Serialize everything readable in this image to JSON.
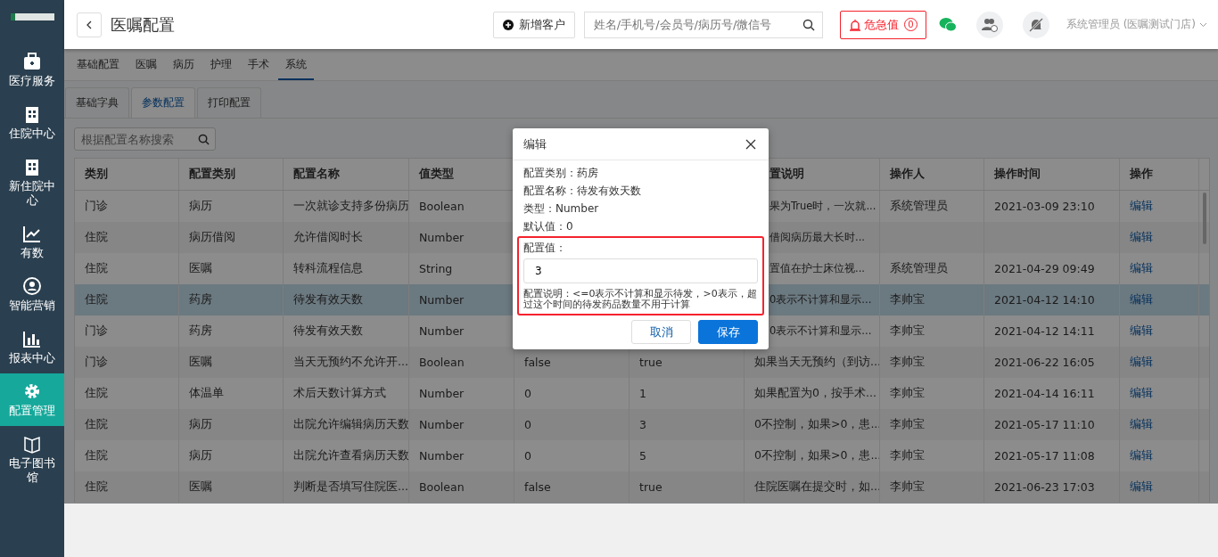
{
  "sidebar": {
    "items": [
      {
        "label": "医疗服务",
        "selected": false
      },
      {
        "label": "住院中心",
        "selected": false
      },
      {
        "label": "新住院中心",
        "selected": false
      },
      {
        "label": "有数",
        "selected": false
      },
      {
        "label": "智能营销",
        "selected": false
      },
      {
        "label": "报表中心",
        "selected": false
      },
      {
        "label": "配置管理",
        "selected": true
      },
      {
        "label": "电子图书馆",
        "selected": false
      }
    ]
  },
  "header": {
    "title": "医嘱配置",
    "add_button": "新增客户",
    "search": {
      "placeholder": "姓名/手机号/会员号/病历号/微信号"
    },
    "alert_button": {
      "label": "危急值",
      "count": "0"
    },
    "user": "系统管理员 (医嘱测试门店)"
  },
  "tabs": [
    {
      "label": "基础配置",
      "selected": false
    },
    {
      "label": "医嘱",
      "selected": false
    },
    {
      "label": "病历",
      "selected": false
    },
    {
      "label": "护理",
      "selected": false
    },
    {
      "label": "手术",
      "selected": false
    },
    {
      "label": "系统",
      "selected": true
    }
  ],
  "sub_tabs": [
    {
      "label": "基础字典",
      "selected": false
    },
    {
      "label": "参数配置",
      "selected": true
    },
    {
      "label": "打印配置",
      "selected": false
    }
  ],
  "filter": {
    "placeholder": "根据配置名称搜索"
  },
  "table": {
    "columns": [
      "类别",
      "配置类别",
      "配置名称",
      "值类型",
      null,
      null,
      "置说明",
      "操作人",
      "操作时间",
      "操作"
    ],
    "rows": [
      {
        "selected": false,
        "cells": [
          "门诊",
          "病历",
          "一次就诊支持多份病历",
          "Boolean",
          null,
          null,
          "果为True时，一次就...",
          "系统管理员",
          "2021-03-09 23:10",
          "编辑"
        ]
      },
      {
        "selected": false,
        "cells": [
          "住院",
          "病历借阅",
          "允许借阅时长",
          "Number",
          null,
          null,
          "借阅病历最大长时...",
          null,
          null,
          "编辑"
        ]
      },
      {
        "selected": false,
        "cells": [
          "住院",
          "医嘱",
          "转科流程信息",
          "String",
          null,
          null,
          "置值在护士床位视...",
          "系统管理员",
          "2021-04-29 09:49",
          "编辑"
        ]
      },
      {
        "selected": true,
        "cells": [
          "住院",
          "药房",
          "待发有效天数",
          "Number",
          null,
          null,
          "0表示不计算和显示...",
          "李帅宝",
          "2021-04-12 14:10",
          "编辑"
        ]
      },
      {
        "selected": false,
        "cells": [
          "门诊",
          "药房",
          "待发有效天数",
          "Number",
          null,
          null,
          "0表示不计算和显示...",
          "李帅宝",
          "2021-04-12 14:11",
          "编辑"
        ]
      },
      {
        "selected": false,
        "cells": [
          "门诊",
          "医嘱",
          "当天无预约不允许开...",
          "Boolean",
          "false",
          "true",
          "如果当天无预约（到访...",
          "李帅宝",
          "2021-06-22 16:05",
          "编辑"
        ]
      },
      {
        "selected": false,
        "cells": [
          "住院",
          "体温单",
          "术后天数计算方式",
          "Number",
          "0",
          "1",
          "如果配置为0，按手术...",
          "李帅宝",
          "2021-04-14 16:11",
          "编辑"
        ]
      },
      {
        "selected": false,
        "cells": [
          "住院",
          "病历",
          "出院允许编辑病历天数",
          "Number",
          "0",
          "3",
          "0不控制，如果>0，患...",
          "李帅宝",
          "2021-05-17 11:10",
          "编辑"
        ]
      },
      {
        "selected": false,
        "cells": [
          "住院",
          "病历",
          "出院允许查看病历天数",
          "Number",
          "0",
          "5",
          "0不控制，如果>0，患...",
          "李帅宝",
          "2021-05-17 11:08",
          "编辑"
        ]
      },
      {
        "selected": false,
        "cells": [
          "住院",
          "医嘱",
          "判断是否填写住院医...",
          "Boolean",
          "false",
          "true",
          "住院医嘱在提交时，如...",
          "李帅宝",
          "2021-06-23 17:03",
          "编辑"
        ]
      }
    ]
  },
  "dialog": {
    "title": "编辑",
    "info": [
      "配置类别：药房",
      "配置名称：待发有效天数",
      "类型：Number",
      "默认值：0"
    ],
    "value_label": "配置值：",
    "value": "3",
    "note": "配置说明：<=0表示不计算和显示待发，>0表示，超过这个时间的待发药品数量不用于计算",
    "buttons": [
      {
        "kind": "secondary",
        "label": "取消"
      },
      {
        "kind": "primary",
        "label": "保存"
      }
    ]
  }
}
